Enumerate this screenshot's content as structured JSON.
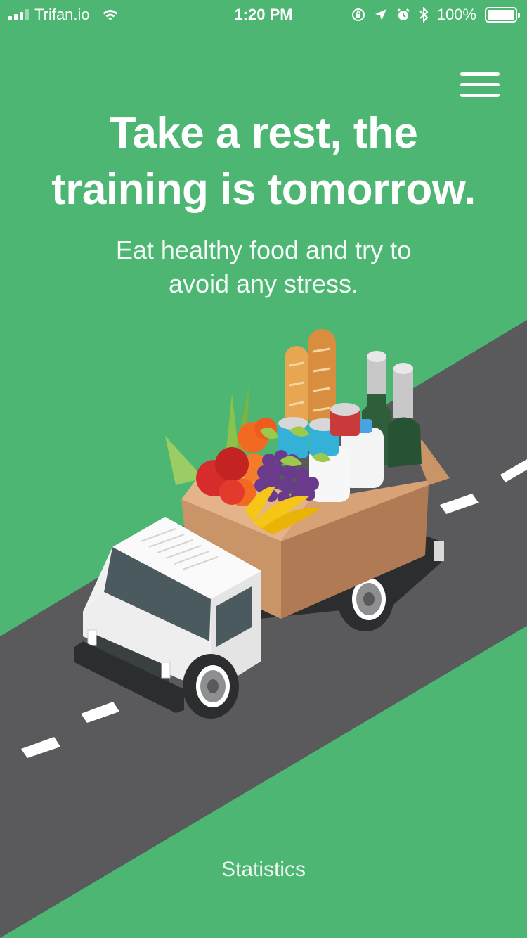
{
  "status_bar": {
    "carrier": "Trifan.io",
    "time": "1:20 PM",
    "battery_percent": "100%",
    "battery_level": 1.0,
    "icons": [
      "signal-icon",
      "wifi-icon",
      "orientation-lock-icon",
      "location-arrow-icon",
      "alarm-icon",
      "bluetooth-icon",
      "battery-icon"
    ]
  },
  "header": {
    "menu_icon": "hamburger-menu-icon"
  },
  "hero": {
    "title_line1": "Take a rest, the",
    "title_line2": "training is tomorrow.",
    "subtitle_line1": "Eat healthy food and try to",
    "subtitle_line2": "avoid any stress."
  },
  "illustration": {
    "subject": "delivery-truck-with-groceries",
    "colors": {
      "background": "#4cb672",
      "road": "#5a5a5d",
      "box": "#c99468",
      "truck": "#f1f1f1"
    }
  },
  "footer": {
    "statistics_label": "Statistics"
  }
}
